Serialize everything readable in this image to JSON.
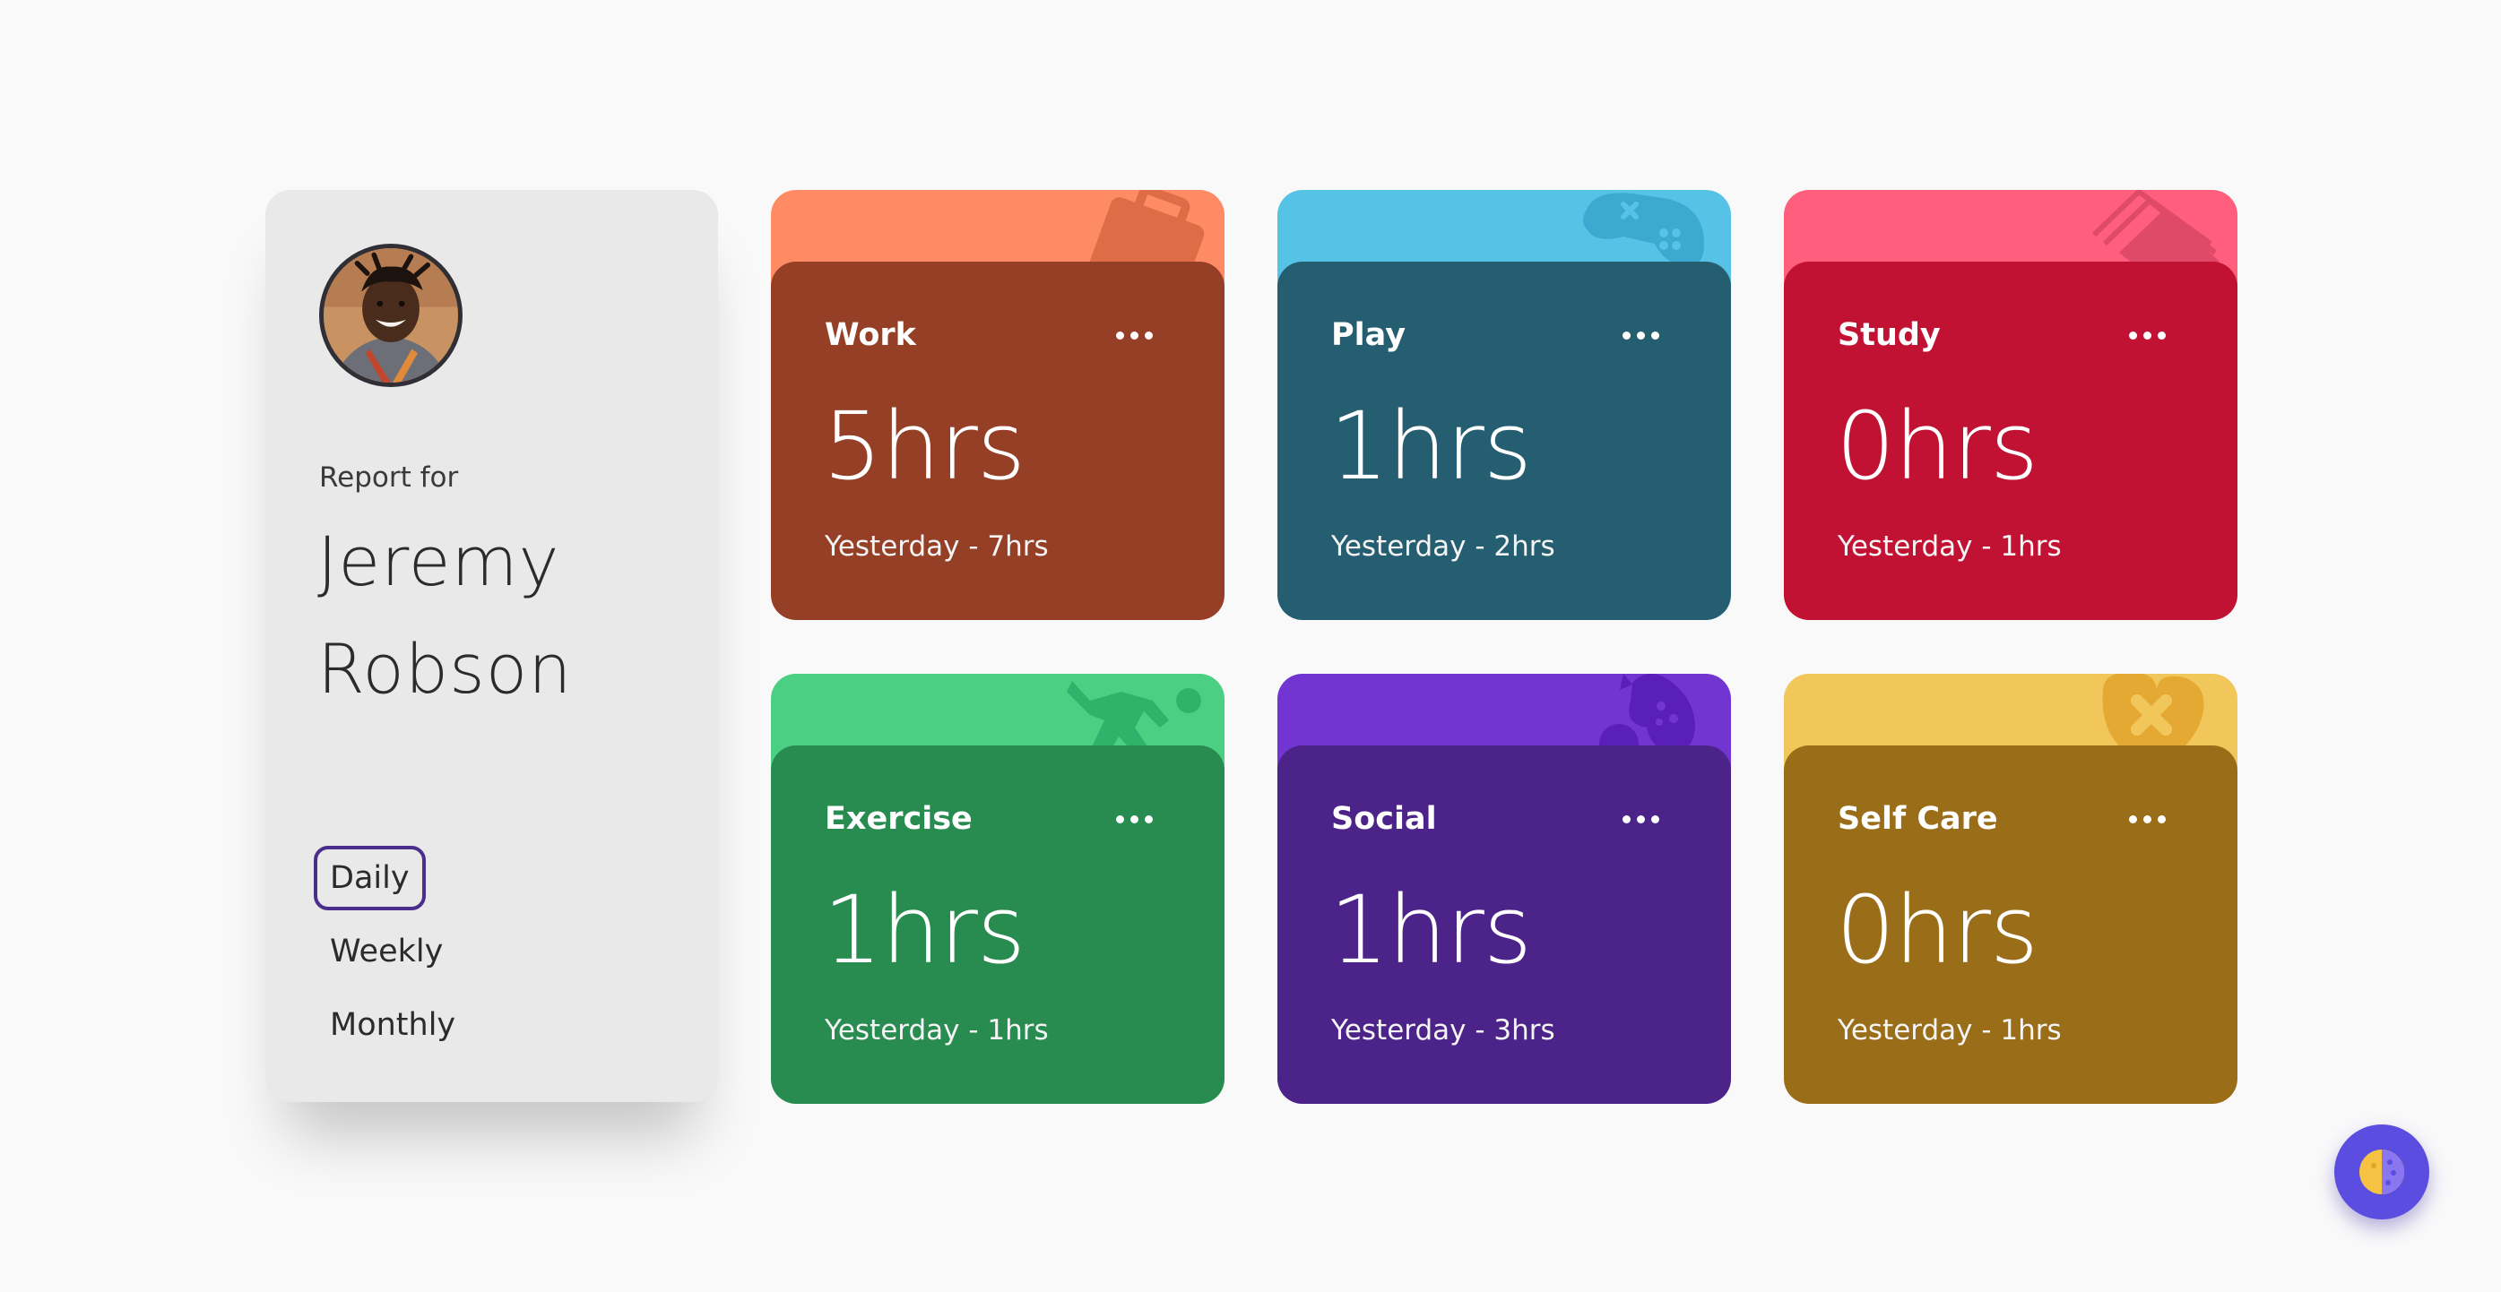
{
  "profile": {
    "report_for": "Report for",
    "first_name": "Jeremy",
    "last_name": "Robson"
  },
  "periods": {
    "daily": "Daily",
    "weekly": "Weekly",
    "monthly": "Monthly",
    "selected": "Daily"
  },
  "cards": [
    {
      "title": "Work",
      "hours": "5hrs",
      "previous": "Yesterday - 7hrs",
      "accent": "#ff8b64",
      "body": "#943f26",
      "icon": "briefcase-icon"
    },
    {
      "title": "Play",
      "hours": "1hrs",
      "previous": "Yesterday - 2hrs",
      "accent": "#55c2e6",
      "body": "#265e71",
      "icon": "gamepad-icon"
    },
    {
      "title": "Study",
      "hours": "0hrs",
      "previous": "Yesterday - 1hrs",
      "accent": "#ff5e7d",
      "body": "#c11233",
      "icon": "books-icon"
    },
    {
      "title": "Exercise",
      "hours": "1hrs",
      "previous": "Yesterday - 1hrs",
      "accent": "#4bcf82",
      "body": "#288c50",
      "icon": "runner-icon"
    },
    {
      "title": "Social",
      "hours": "1hrs",
      "previous": "Yesterday - 3hrs",
      "accent": "#7335d2",
      "body": "#4b2389",
      "icon": "social-icon"
    },
    {
      "title": "Self Care",
      "hours": "0hrs",
      "previous": "Yesterday - 1hrs",
      "accent": "#f1c75b",
      "body": "#9a6d19",
      "icon": "heart-icon"
    }
  ],
  "theme_toggle_icon": "palette-icon"
}
